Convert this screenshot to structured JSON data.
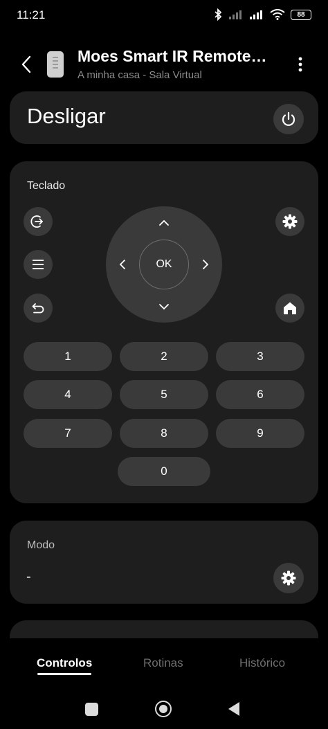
{
  "status_bar": {
    "time": "11:21",
    "battery": "88"
  },
  "header": {
    "title": "Moes Smart IR Remote…",
    "subtitle": "A minha casa - Sala Virtual"
  },
  "power": {
    "label": "Desligar"
  },
  "keypad": {
    "label": "Teclado",
    "ok_label": "OK",
    "numbers": [
      "1",
      "2",
      "3",
      "4",
      "5",
      "6",
      "7",
      "8",
      "9",
      "0"
    ]
  },
  "mode": {
    "label": "Modo",
    "value": "-"
  },
  "tabs": [
    {
      "label": "Controlos",
      "active": true
    },
    {
      "label": "Rotinas",
      "active": false
    },
    {
      "label": "Histórico",
      "active": false
    }
  ],
  "colors": {
    "background": "#000000",
    "card": "#1e1e1e",
    "button": "#3a3a3a"
  }
}
